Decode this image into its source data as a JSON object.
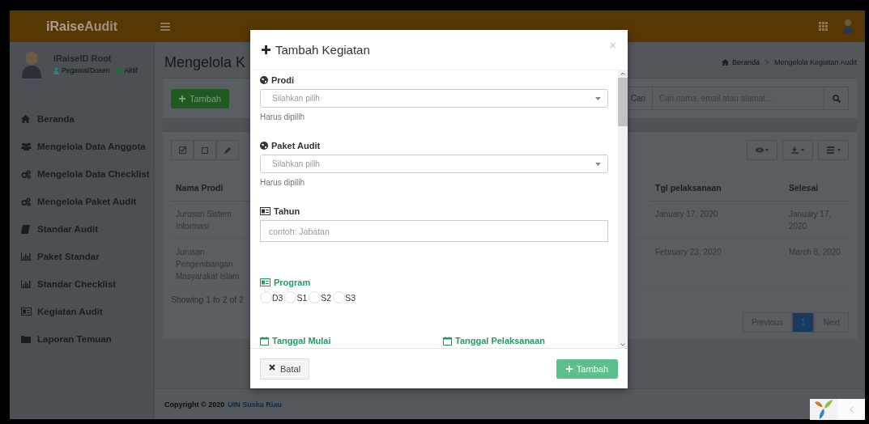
{
  "app": {
    "logo": "**iRaise**Audit"
  },
  "user": {
    "name": "iRaiseID Root",
    "role": "Pegawai/Dosen",
    "status": "Aktif",
    "online": true
  },
  "sidebar": {
    "items": [
      "Beranda",
      "Mengelola Data Anggota",
      "Mengelola Data Checklist",
      "Mengelola Paket Audit",
      "Standar Audit",
      "Paket Standar",
      "Standar Checklist",
      "Kegiatan Audit",
      "Laporan Temuan"
    ]
  },
  "page": {
    "title": "Mengelola K",
    "breadcrumb": [
      "Beranda",
      "Mengelola Kegiatan Audit"
    ]
  },
  "toolbar": {
    "add_button": "Tambah",
    "search_label": "Cari",
    "search_placeholder": "Cari nama, email atau alamat..."
  },
  "table": {
    "columns": [
      "Nama Prodi",
      "Tgl pelaksanaan",
      "Selesai"
    ],
    "rows": [
      [
        "Jurusan Sistem Informasi",
        "January 17, 2020",
        "January 17, 2020"
      ],
      [
        "Jurusan Pengembangan Masyarakat Islam",
        "February 23, 2020",
        "March 8, 2020"
      ]
    ],
    "summary": "Showing 1 to 2 of 2",
    "pagination": [
      {
        "label": "Previous",
        "selected": false
      },
      {
        "label": "1",
        "selected": true
      },
      {
        "label": "Next",
        "selected": false
      }
    ]
  },
  "footer": {
    "text": "Copyright © 2020",
    "link": "UIN Suska Riau"
  },
  "modal": {
    "title": "Tambah Kegiatan",
    "close": "×",
    "fields": [
      {
        "kind": "select",
        "label": "Prodi",
        "valid": false,
        "placeholder": "Silahkan pilih",
        "help": "Harus dipilih"
      },
      {
        "kind": "select",
        "label": "Paket Audit",
        "valid": false,
        "placeholder": "Silahkan pilih",
        "help": "Harus dipilih"
      },
      {
        "kind": "text",
        "label": "Tahun",
        "valid": false,
        "placeholder": "contoh: Jabatan"
      },
      {
        "kind": "radio",
        "label": "Program",
        "valid": true,
        "options": [
          {
            "label": "D3",
            "selected": false
          },
          {
            "label": "S1",
            "selected": false
          },
          {
            "label": "S2",
            "selected": false
          },
          {
            "label": "S3",
            "selected": false
          }
        ]
      },
      {
        "kind": "date_pair",
        "dates": [
          {
            "label": "Tanggal Mulai",
            "valid": true
          },
          {
            "label": "Tanggal Pelaksanaan",
            "valid": true
          }
        ]
      }
    ],
    "cancel": "Batal",
    "submit": "Tambah"
  }
}
